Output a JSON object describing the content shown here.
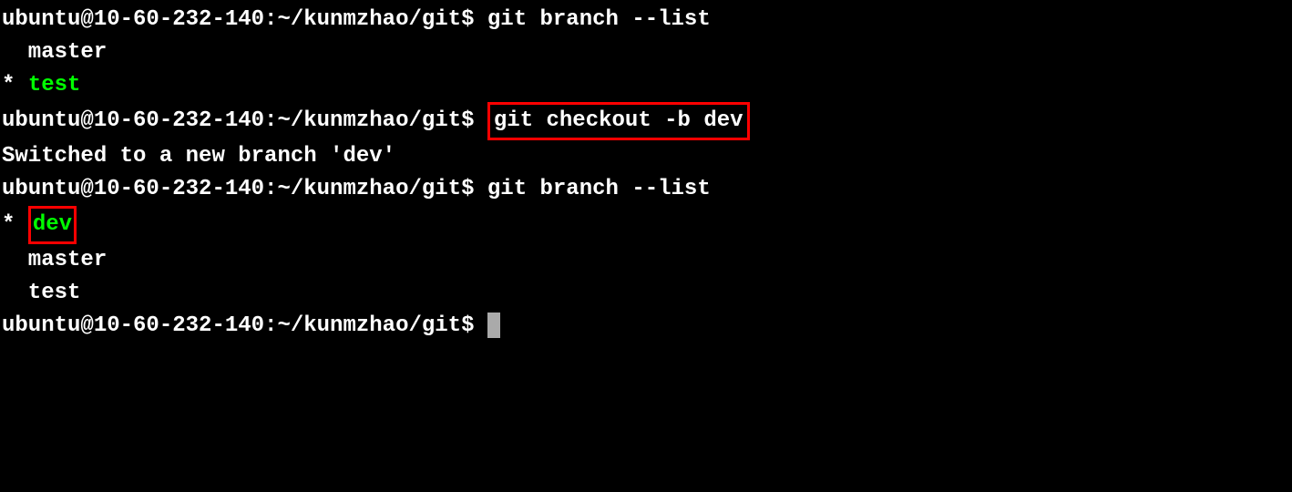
{
  "prompt1": "ubuntu@10-60-232-140:~/kunmzhao/git$ ",
  "cmd1": "git branch --list",
  "branch_master_indent": "  master",
  "branch_test_asterisk": "* ",
  "branch_test": "test",
  "prompt2": "ubuntu@10-60-232-140:~/kunmzhao/git$ ",
  "cmd2": "git checkout -b dev",
  "switched_msg": "Switched to a new branch 'dev'",
  "prompt3": "ubuntu@10-60-232-140:~/kunmzhao/git$ ",
  "cmd3": "git branch --list",
  "branch_dev_asterisk": "* ",
  "branch_dev": "dev",
  "branch_master2": "  master",
  "branch_test2": "  test",
  "prompt4": "ubuntu@10-60-232-140:~/kunmzhao/git$ "
}
